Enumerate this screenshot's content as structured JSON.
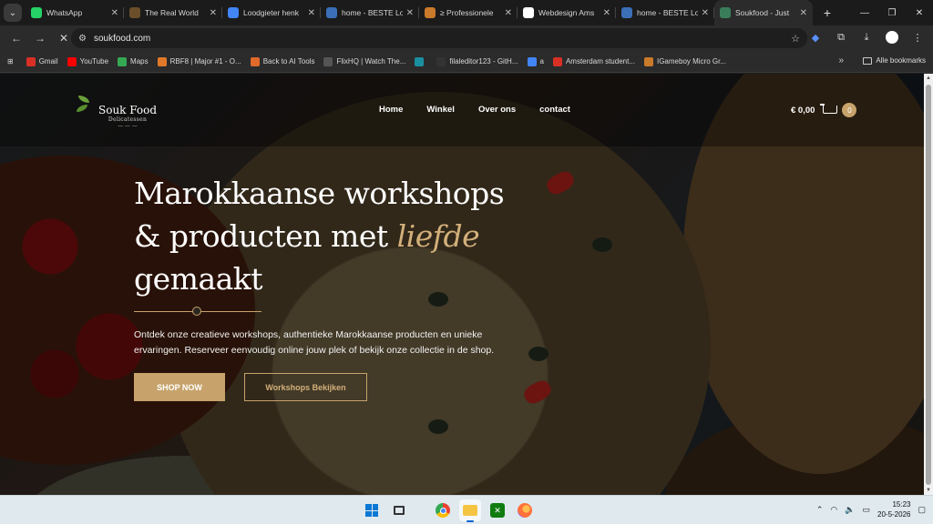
{
  "browser": {
    "tabs": [
      {
        "label": "WhatsApp",
        "icon": "whatsapp-icon",
        "color": "#25d366"
      },
      {
        "label": "The Real World",
        "icon": "real-world-icon",
        "color": "#6b4f2a"
      },
      {
        "label": "Loodgieter henk",
        "icon": "google-icon",
        "color": "#4285f4"
      },
      {
        "label": "home - BESTE Lo",
        "icon": "site-icon",
        "color": "#3b6fb6"
      },
      {
        "label": "≥ Professionele ",
        "icon": "bitcoin-icon",
        "color": "#c97a2a"
      },
      {
        "label": "Webdesign Ams",
        "icon": "webdesign-icon",
        "color": "#ffffff"
      },
      {
        "label": "home - BESTE Lo",
        "icon": "site-icon",
        "color": "#3b6fb6"
      },
      {
        "label": "Soukfood - Just",
        "icon": "soukfood-icon",
        "color": "#3a7d5a",
        "active": true
      }
    ],
    "new_tab": "+",
    "url": "soukfood.com",
    "bookmarks": [
      {
        "label": "Gmail",
        "color": "#d93025"
      },
      {
        "label": "YouTube",
        "color": "#ff0000"
      },
      {
        "label": "Maps",
        "color": "#34a853"
      },
      {
        "label": "RBF8 | Major #1 - O...",
        "color": "#e07a2a"
      },
      {
        "label": "Back to AI Tools",
        "color": "#e06a2a"
      },
      {
        "label": "FlixHQ | Watch The...",
        "color": "#555555"
      },
      {
        "label": "",
        "color": "#1a8fa0"
      },
      {
        "label": "filaleditor123 - GitH...",
        "color": "#333333"
      },
      {
        "label": "a",
        "color": "#4285f4"
      },
      {
        "label": "Amsterdam student...",
        "color": "#d93025"
      },
      {
        "label": "IGameboy Micro Gr...",
        "color": "#c97a2a"
      }
    ],
    "bookmarks_more": "»",
    "all_bookmarks": "Alle bookmarks"
  },
  "site": {
    "logo": {
      "name": "Souk Food",
      "tagline": "Delicatessen"
    },
    "menu": [
      "Home",
      "Winkel",
      "Over ons",
      "contact"
    ],
    "cart": {
      "amount": "€ 0,00",
      "count": "0"
    },
    "hero": {
      "title_line1": "Marokkaanse workshops",
      "title_line2_pre": "& producten met ",
      "title_accent": "liefde",
      "title_line3": "gemaakt",
      "description": "Ontdek onze creatieve workshops, authentieke Marokkaanse producten en unieke ervaringen. Reserveer eenvoudig online jouw plek of bekijk onze collectie in de shop.",
      "primary_button": "SHOP NOW",
      "secondary_button": "Workshops Bekijken"
    },
    "colors": {
      "accent": "#c7a36b"
    }
  },
  "taskbar": {
    "time": "15:23",
    "date": "20-5-2026"
  }
}
